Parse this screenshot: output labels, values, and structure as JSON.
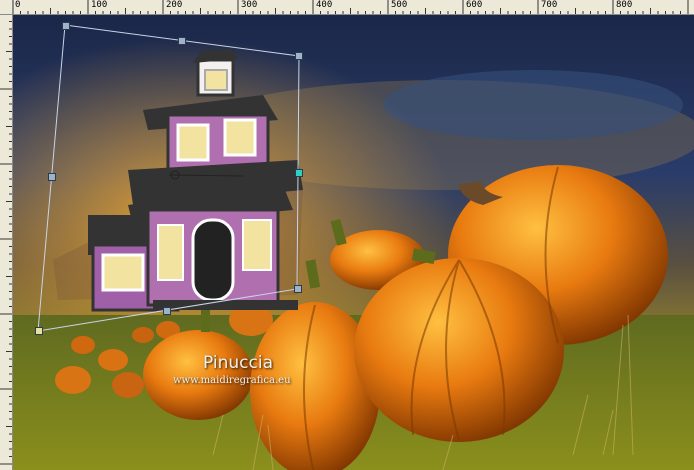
{
  "ruler": {
    "labels": [
      "0",
      "100",
      "200",
      "300",
      "400",
      "500",
      "600",
      "700",
      "800"
    ]
  },
  "watermark": {
    "name": "Pinuccia",
    "site": "www.maidiregrafica.eu"
  },
  "colors": {
    "sky_top": "#1d2c4e",
    "sky_glow": "#e8a030",
    "grass": "#6f7a1e",
    "pumpkin": "#e07a10",
    "house_purple": "#b070b0",
    "selection": "#c9d4e6"
  },
  "icons": {
    "rotate_handle": "crosshair-icon"
  }
}
